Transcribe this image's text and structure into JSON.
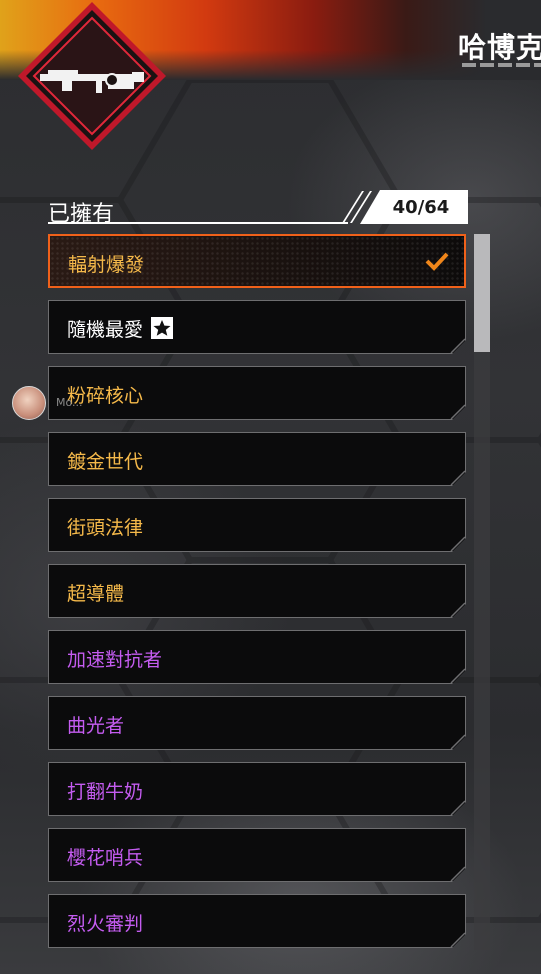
{
  "header": {
    "title": "哈博克"
  },
  "owned": {
    "label": "已擁有",
    "count": "40/64"
  },
  "items": [
    {
      "label": "輻射爆發",
      "color": "#f5b94a",
      "selected": true
    },
    {
      "label": "隨機最愛",
      "color": "#ffffff",
      "badge": "star-icon"
    },
    {
      "label": "粉碎核心",
      "color": "#f5b94a"
    },
    {
      "label": "鍍金世代",
      "color": "#f5b94a"
    },
    {
      "label": "街頭法律",
      "color": "#f5b94a"
    },
    {
      "label": "超導體",
      "color": "#f5b94a"
    },
    {
      "label": "加速對抗者",
      "color": "#c45cf0"
    },
    {
      "label": "曲光者",
      "color": "#c45cf0"
    },
    {
      "label": "打翻牛奶",
      "color": "#c45cf0"
    },
    {
      "label": "櫻花哨兵",
      "color": "#c45cf0"
    },
    {
      "label": "烈火審判",
      "color": "#c45cf0"
    }
  ],
  "overlay": {
    "avatar_name": "Mo..."
  },
  "colors": {
    "accent": "#f0611a",
    "legendary": "#f5b94a",
    "epic": "#c45cf0"
  }
}
